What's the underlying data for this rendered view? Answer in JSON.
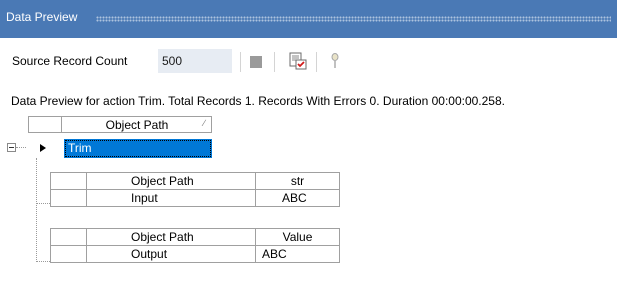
{
  "window": {
    "title": "Data Preview"
  },
  "toolbar": {
    "source_count_label": "Source Record Count",
    "source_count_value": "500"
  },
  "summary": "Data Preview for action Trim. Total Records 1. Records With Errors 0. Duration 00:00:00.258.",
  "grid": {
    "header": {
      "column": "Object Path"
    },
    "root_row": {
      "value": "Trim"
    },
    "input_table": {
      "headers": [
        "Object Path",
        "str"
      ],
      "row": [
        "Input",
        "ABC"
      ]
    },
    "output_table": {
      "headers": [
        "Object Path",
        "Value"
      ],
      "row": [
        "Output",
        "ABC"
      ]
    }
  },
  "icons": {
    "stop": "stop-icon",
    "preview": "preview-check-icon",
    "pin": "pin-icon"
  },
  "colors": {
    "titlebar": "#4a79b5",
    "selected_row": "#0078d7",
    "input_bg": "#e7ecf3"
  }
}
